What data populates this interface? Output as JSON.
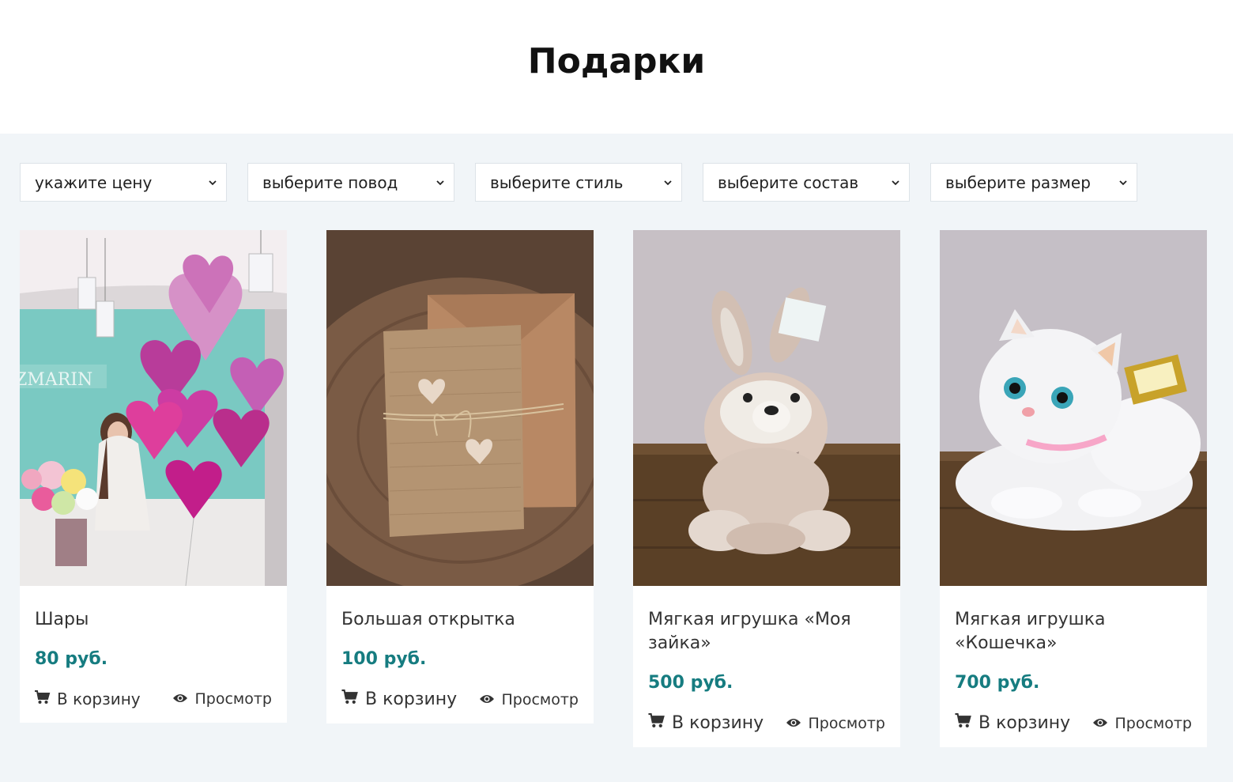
{
  "page": {
    "title": "Подарки"
  },
  "filters": [
    {
      "label": "укажите цену"
    },
    {
      "label": "выберите повод"
    },
    {
      "label": "выберите стиль"
    },
    {
      "label": "выберите состав"
    },
    {
      "label": "выберите размер"
    }
  ],
  "products": [
    {
      "name": "Шары",
      "price": "80 руб.",
      "cart_label": "В корзину",
      "view_label": "Просмотр",
      "image_text": "ZMARIN"
    },
    {
      "name": "Большая открытка",
      "price": "100 руб.",
      "cart_label": "В корзину",
      "view_label": "Просмотр"
    },
    {
      "name": "Мягкая игрушка «Моя зайка»",
      "price": "500 руб.",
      "cart_label": "В корзину",
      "view_label": "Просмотр"
    },
    {
      "name": "Мягкая игрушка «Кошечка»",
      "price": "700 руб.",
      "cart_label": "В корзину",
      "view_label": "Просмотр"
    }
  ],
  "colors": {
    "price": "#167c80",
    "background": "#f1f5f8"
  },
  "icons": {
    "cart": "cart-icon",
    "view": "eye-icon",
    "dropdown": "chevron-down-icon"
  }
}
